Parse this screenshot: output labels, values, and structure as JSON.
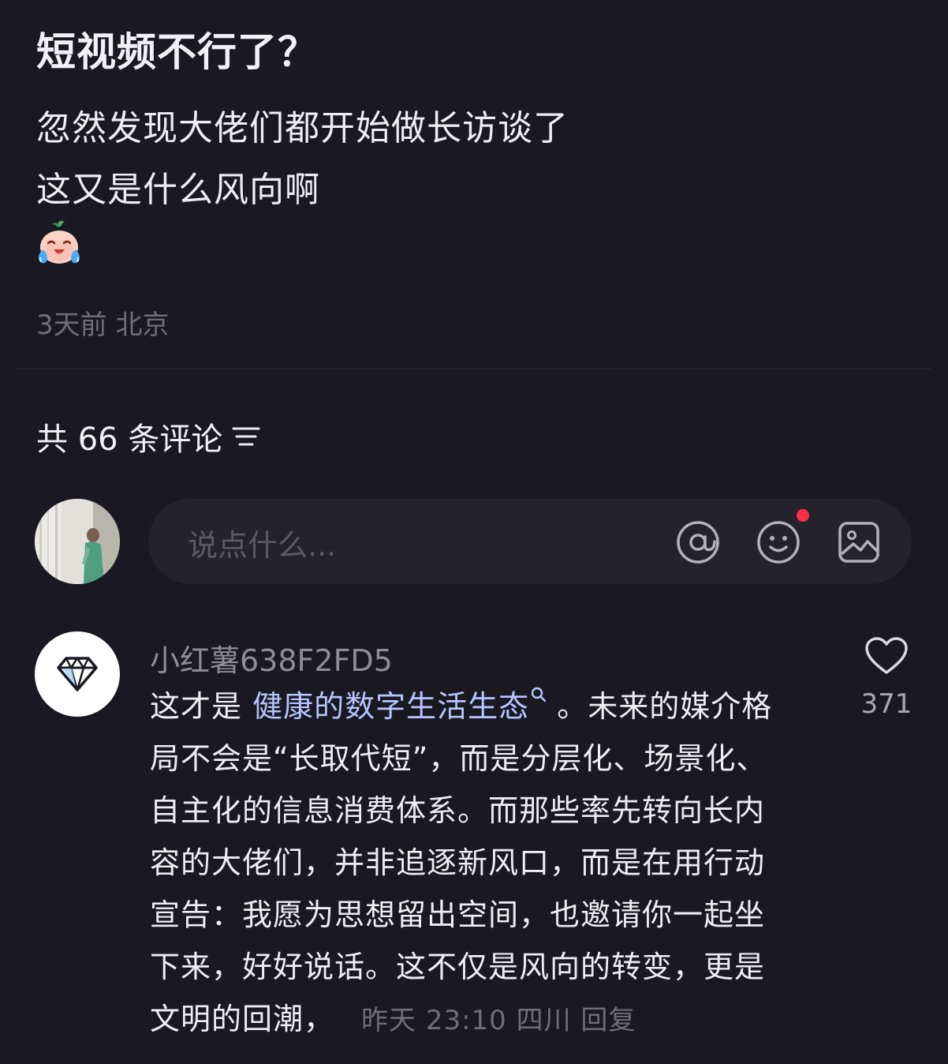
{
  "post": {
    "title": "短视频不行了？",
    "body_lines": [
      "忽然发现大佬们都开始做长访谈了",
      "这又是什么风向啊"
    ],
    "emoji": "crying-face-emoji",
    "meta": "3天前 北京"
  },
  "comments_header": {
    "count_label": "共 66 条评论"
  },
  "comment_input": {
    "placeholder": "说点什么..."
  },
  "comment": {
    "username": "小红薯638F2FD5",
    "avatar_icon": "diamond-icon",
    "text_line1_prefix": "这才是 ",
    "text_link": "健康的数字生活生态",
    "text_line1_suffix": " 。未来的媒介格",
    "text_lines": [
      "局不会是“长取代短”，而是分层化、场景化、",
      "自主化的信息消费体系。而那些率先转向长内",
      "容的大佬们，并非追逐新风口，而是在用行动",
      "宣告：我愿为思想留出空间，也邀请你一起坐",
      "下来，好好说话。这不仅是风向的转变，更是"
    ],
    "text_last_line": "文明的回潮，",
    "meta": "昨天 23:10 四川 回复",
    "like_count": "371"
  },
  "colors": {
    "background": "#1a1922",
    "link": "#b7c5ff",
    "notification_dot": "#ff2d4a",
    "muted_text": "#6f6e77"
  }
}
